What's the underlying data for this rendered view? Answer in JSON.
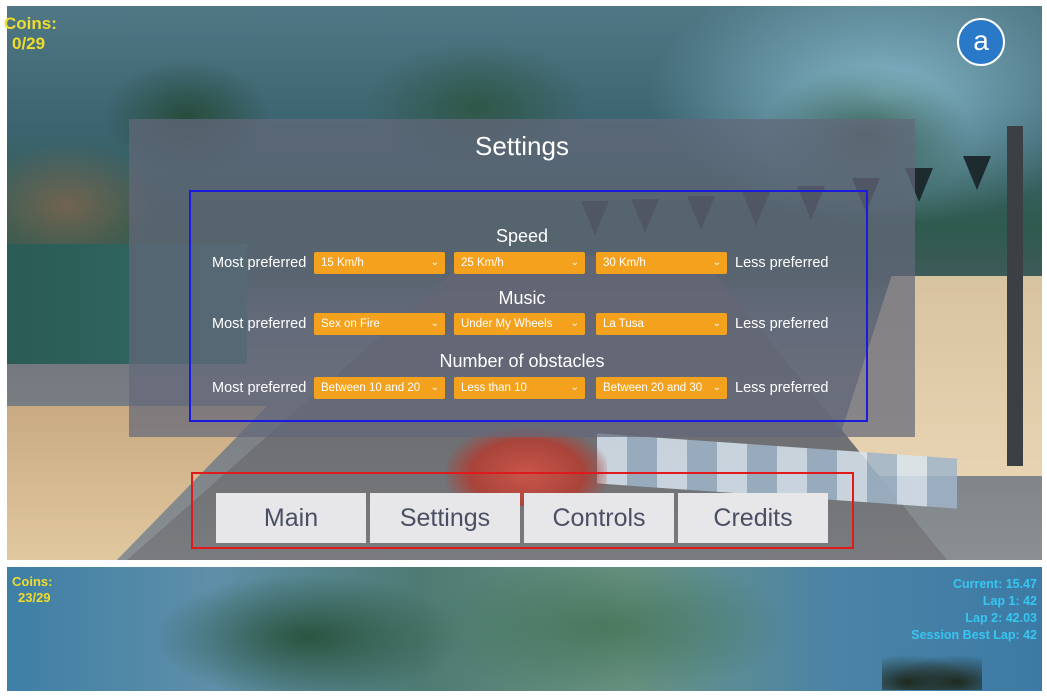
{
  "hud_top": {
    "coins_label": "Coins:",
    "coins_value": "0/29"
  },
  "badge": {
    "label": "a"
  },
  "settings": {
    "title": "Settings",
    "most_label": "Most preferred",
    "less_label": "Less preferred",
    "sections": [
      {
        "title": "Speed",
        "options": [
          "15 Km/h",
          "25 Km/h",
          "30 Km/h"
        ]
      },
      {
        "title": "Music",
        "options": [
          "Sex on Fire",
          "Under My Wheels",
          "La Tusa"
        ]
      },
      {
        "title": "Number of obstacles",
        "options": [
          "Between 10 and 20",
          "Less than 10",
          "Between 20 and 30"
        ]
      }
    ]
  },
  "menu": {
    "buttons": [
      "Main",
      "Settings",
      "Controls",
      "Credits"
    ]
  },
  "hud_bottom": {
    "coins_label": "Coins:",
    "coins_value": "23/29",
    "current": "Current: 15.47",
    "lap1": "Lap 1: 42",
    "lap2": "Lap 2: 42.03",
    "best": "Session Best Lap: 42"
  },
  "colors": {
    "dropdown": "#f4a21e",
    "coins": "#f0dc2c",
    "laps": "#37c6f0",
    "highlight_settings": "#1a1ae0",
    "highlight_menu": "#e01a1a"
  },
  "icons": {
    "dropdown_chevron": "chevron-down-icon"
  }
}
